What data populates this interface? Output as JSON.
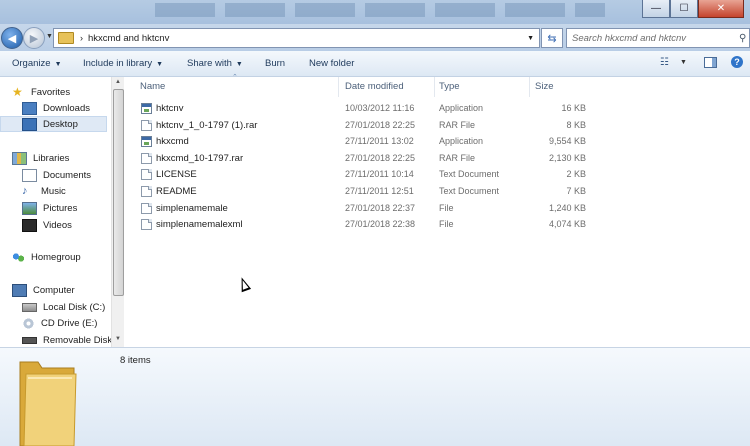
{
  "window": {
    "minimize_glyph": "—",
    "maximize_glyph": "☐",
    "close_glyph": "✕"
  },
  "address": {
    "path_separator": "›",
    "path": "hkxcmd and hktcnv",
    "search_placeholder": "Search hkxcmd and hktcnv"
  },
  "toolbar": {
    "organize": "Organize",
    "include_in_library": "Include in library",
    "share_with": "Share with",
    "burn": "Burn",
    "new_folder": "New folder"
  },
  "nav": {
    "favorites": "Favorites",
    "downloads": "Downloads",
    "desktop": "Desktop",
    "libraries": "Libraries",
    "documents": "Documents",
    "music": "Music",
    "pictures": "Pictures",
    "videos": "Videos",
    "homegroup": "Homegroup",
    "computer": "Computer",
    "local_disk": "Local Disk (C:)",
    "cd_drive": "CD Drive (E:)",
    "removable_disk": "Removable Disk ("
  },
  "columns": {
    "name": "Name",
    "date_modified": "Date modified",
    "type": "Type",
    "size": "Size"
  },
  "files": [
    {
      "name": "hktcnv",
      "date": "10/03/2012 11:16",
      "type": "Application",
      "size": "16 KB",
      "icon": "application-icon"
    },
    {
      "name": "hktcnv_1_0-1797 (1).rar",
      "date": "27/01/2018 22:25",
      "type": "RAR File",
      "size": "8 KB",
      "icon": "file-icon"
    },
    {
      "name": "hkxcmd",
      "date": "27/11/2011 13:02",
      "type": "Application",
      "size": "9,554 KB",
      "icon": "application-icon"
    },
    {
      "name": "hkxcmd_10-1797.rar",
      "date": "27/01/2018 22:25",
      "type": "RAR File",
      "size": "2,130 KB",
      "icon": "file-icon"
    },
    {
      "name": "LICENSE",
      "date": "27/11/2011 10:14",
      "type": "Text Document",
      "size": "2 KB",
      "icon": "file-icon"
    },
    {
      "name": "README",
      "date": "27/11/2011 12:51",
      "type": "Text Document",
      "size": "7 KB",
      "icon": "file-icon"
    },
    {
      "name": "simplenamemale",
      "date": "27/01/2018 22:37",
      "type": "File",
      "size": "1,240 KB",
      "icon": "file-icon"
    },
    {
      "name": "simplenamemalexml",
      "date": "27/01/2018 22:38",
      "type": "File",
      "size": "4,074 KB",
      "icon": "file-icon"
    }
  ],
  "details": {
    "item_count": "8 items"
  },
  "colors": {
    "title_bar": "#b5cbe3",
    "selection": "#dfe9f5",
    "header_text": "#4c607a",
    "folder": "#e7c25a"
  }
}
